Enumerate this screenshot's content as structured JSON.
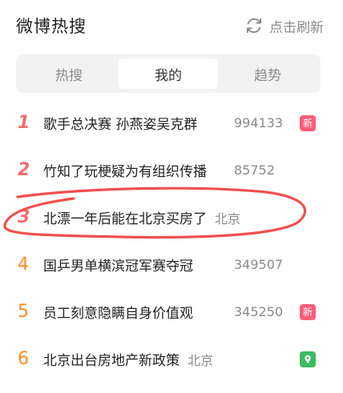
{
  "header": {
    "title": "微博热搜",
    "refresh_label": "点击刷新",
    "refresh_icon": "refresh-icon"
  },
  "tabs": [
    {
      "label": "热搜",
      "active": false
    },
    {
      "label": "我的",
      "active": true
    },
    {
      "label": "趋势",
      "active": false
    }
  ],
  "items": [
    {
      "rank": "1",
      "text": "歌手总决赛 孙燕姿吴克群",
      "value": "994133",
      "badge": "新",
      "badge_type": "new"
    },
    {
      "rank": "2",
      "text": "竹知了玩梗疑为有组织传播",
      "value": "85752",
      "badge": "",
      "badge_type": ""
    },
    {
      "rank": "3",
      "text": "北漂一年后能在北京买房了",
      "value": "北京",
      "badge": "",
      "badge_type": ""
    },
    {
      "rank": "4",
      "text": "国乒男单横滨冠军赛夺冠",
      "value": "349507",
      "badge": "",
      "badge_type": ""
    },
    {
      "rank": "5",
      "text": "员工刻意隐瞒自身价值观",
      "value": "345250",
      "badge": "新",
      "badge_type": "new"
    },
    {
      "rank": "6",
      "text": "北京出台房地产新政策",
      "value": "北京",
      "badge": "",
      "badge_type": "location"
    }
  ],
  "colors": {
    "rank_top": "#f26d6d",
    "rank_other": "#ff8a1f",
    "annotation": "#f0504f"
  }
}
